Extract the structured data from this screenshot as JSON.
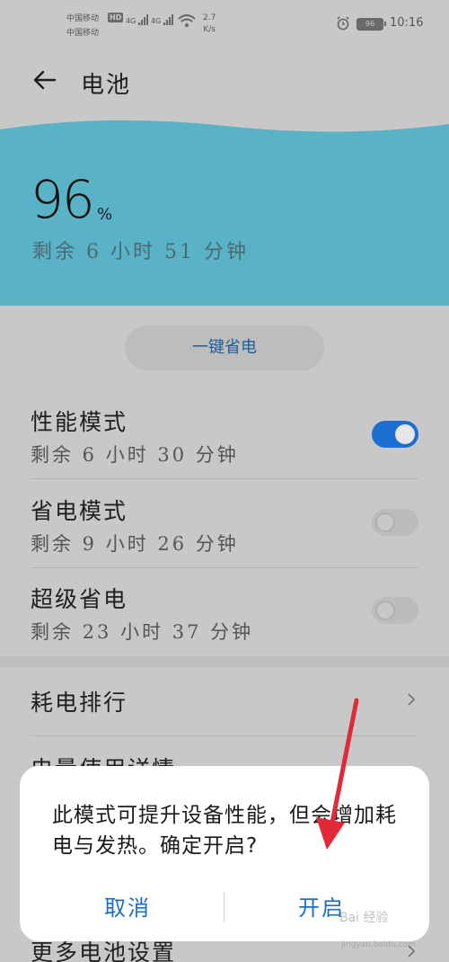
{
  "status_bar": {
    "carrier1": "中国移动",
    "carrier2": "中国移动",
    "hd": "HD",
    "net1": "4G",
    "net2": "4G",
    "speed_value": "2.7",
    "speed_unit": "K/s",
    "battery": "96",
    "time": "10:16"
  },
  "header": {
    "title": "电池"
  },
  "battery": {
    "percent": "96",
    "percent_sign": "%",
    "remaining": "剩余 6 小时 51 分钟"
  },
  "one_key_button": "一键省电",
  "modes": [
    {
      "title": "性能模式",
      "subtitle": "剩余 6 小时 30 分钟",
      "enabled": true
    },
    {
      "title": "省电模式",
      "subtitle": "剩余 9 小时 26 分钟",
      "enabled": false
    },
    {
      "title": "超级省电",
      "subtitle": "剩余 23 小时 37 分钟",
      "enabled": false
    }
  ],
  "menu": {
    "item1": "耗电排行",
    "item2_partial": "电量使用详情",
    "item3": "更多电池设置"
  },
  "dialog": {
    "message": "此模式可提升设备性能，但会增加耗电与发热。确定开启?",
    "cancel": "取消",
    "confirm": "开启"
  },
  "watermark": {
    "text": "Bai 经验",
    "url": "jingyan.baidu.com"
  },
  "colors": {
    "accent": "#1a6fc4",
    "hero": "#5ab2c6",
    "toggle_on": "#1c6fd0",
    "annotation_arrow": "#e02a3a"
  }
}
